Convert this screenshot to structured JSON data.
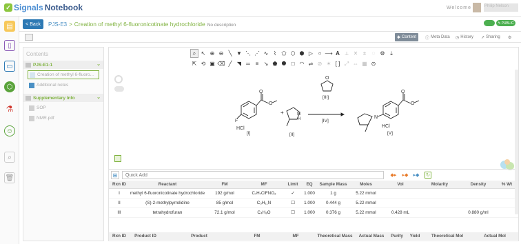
{
  "app": {
    "logo_text_1": "Signals",
    "logo_text_2": "Notebook",
    "welcome": "Welcome",
    "username": "Philip Nelson"
  },
  "header": {
    "back_label": "Back",
    "experiment_id": "PJS-E3",
    "title": "Creation of methyl 6-fluoronicotinate hydrochloride",
    "description": "No description",
    "public_label": "PUBLIC"
  },
  "subtabs": [
    {
      "label": "Content",
      "active": true,
      "icon": "puzzle-icon"
    },
    {
      "label": "Meta Data",
      "active": false,
      "icon": "info-icon"
    },
    {
      "label": "History",
      "active": false,
      "icon": "clock-icon"
    },
    {
      "label": "Sharing",
      "active": false,
      "icon": "share-icon"
    }
  ],
  "contents": {
    "heading": "Contents",
    "section1": "PJS-E1-1",
    "items1": [
      "Creation of methyl 6-fluoro...",
      "Additional notes"
    ],
    "section2": "Supplementary Info",
    "items2": [
      "SOP",
      "NMR.pdf"
    ]
  },
  "reaction": {
    "sm1_salt": "HCl",
    "sm1_label": "[I]",
    "sm2_label": "[II]",
    "reagent_label": "[III]",
    "condition_label": "[IV]",
    "product_label": "[V]",
    "plus": "+",
    "atom_F": "F",
    "atom_N": "N",
    "atom_NH": "N",
    "atom_H": "H",
    "atom_O": "O"
  },
  "quick_add": {
    "placeholder": "Quick Add"
  },
  "reactants": {
    "headers": [
      "Rxn ID",
      "Reactant",
      "FM",
      "MF",
      "Limit",
      "EQ",
      "Sample Mass",
      "Moles",
      "Vol",
      "Molarity",
      "Density",
      "% Wt"
    ],
    "rows": [
      {
        "id": "I",
        "name": "methyl 6-fluoronicotinate hydrochloride",
        "fm": "192 g/mol",
        "mf": "C₇H₇ClFNO₂",
        "limit": "✓",
        "eq": "1.000",
        "mass": "1 g",
        "moles": "5.22 mmol",
        "vol": "",
        "molarity": "",
        "density": "",
        "wt": ""
      },
      {
        "id": "II",
        "name": "(S)-2-methylpyrrolidine",
        "fm": "85 g/mol",
        "mf": "C₅H₁₁N",
        "limit": "☐",
        "eq": "1.000",
        "mass": "0.444 g",
        "moles": "5.22 mmol",
        "vol": "",
        "molarity": "",
        "density": "",
        "wt": ""
      },
      {
        "id": "III",
        "name": "tetrahydrofuran",
        "fm": "72.1 g/mol",
        "mf": "C₄H₈O",
        "limit": "☐",
        "eq": "1.000",
        "mass": "0.376 g",
        "moles": "5.22 mmol",
        "vol": "0.428 mL",
        "molarity": "",
        "density": "0.880 g/ml",
        "wt": ""
      }
    ]
  },
  "products": {
    "headers": [
      "Rxn ID",
      "Product ID",
      "Product",
      "FM",
      "MF",
      "Theoretical Mass",
      "Actual Mass",
      "Purity",
      "Yield",
      "Theoretical Mol",
      "Actual Mol"
    ]
  },
  "colors": {
    "accent_green": "#7fb23f",
    "accent_blue": "#2d79b4",
    "public_green": "#4caf50"
  }
}
